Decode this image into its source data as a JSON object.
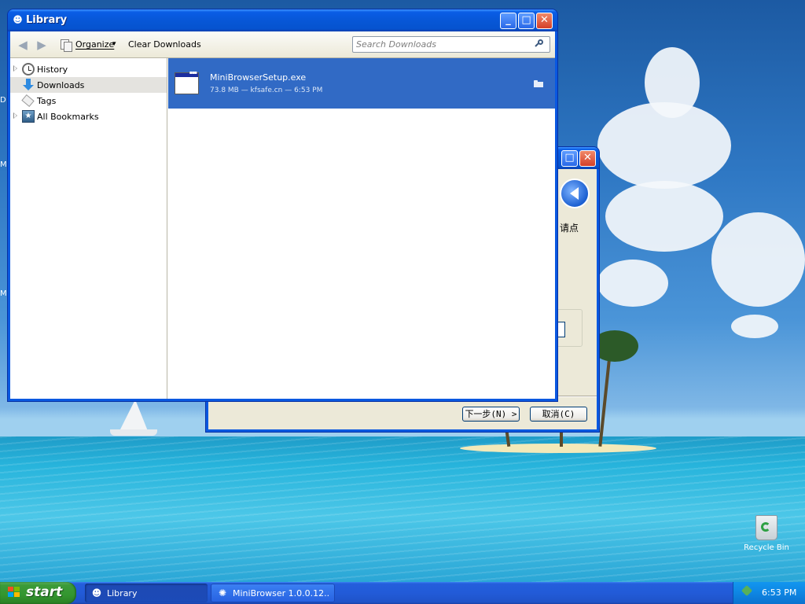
{
  "desktop": {
    "edge_labels": [
      "D",
      "M",
      "M"
    ],
    "recycle_bin_label": "Recycle Bin"
  },
  "installer": {
    "visible_text": "请点",
    "next_button": "下一步(N) >",
    "cancel_button": "取消(C)",
    "caption_buttons": {
      "maximize": "□",
      "close": "✕"
    }
  },
  "library": {
    "title": "Library",
    "caption_buttons": {
      "minimize": "_",
      "maximize": "□",
      "close": "✕"
    },
    "toolbar": {
      "organize_label": "Organize",
      "organize_arrow": "▾",
      "clear_downloads_label": "Clear Downloads",
      "search_placeholder": "Search Downloads"
    },
    "sidebar": {
      "items": [
        {
          "label": "History",
          "icon": "clock-icon",
          "expandable": true,
          "selected": false
        },
        {
          "label": "Downloads",
          "icon": "download-icon",
          "expandable": false,
          "selected": true
        },
        {
          "label": "Tags",
          "icon": "tag-icon",
          "expandable": false,
          "selected": false
        },
        {
          "label": "All Bookmarks",
          "icon": "bookmarks-star-icon",
          "expandable": true,
          "selected": false
        }
      ]
    },
    "downloads": [
      {
        "file_name": "MiniBrowserSetup.exe",
        "details": "73.8 MB — kfsafe.cn — 6:53 PM",
        "icon": "exe-file-icon",
        "action_icon": "open-folder-icon",
        "selected": true
      }
    ]
  },
  "taskbar": {
    "start_label": "start",
    "buttons": [
      {
        "label": "Library",
        "icon": "firefox-icon",
        "active": true
      },
      {
        "label": "MiniBrowser 1.0.0.12...",
        "icon": "minibrowser-icon",
        "active": false
      }
    ],
    "clock": "6:53 PM"
  },
  "colors": {
    "selection": "#316ac5",
    "titlebar": "#0757d7",
    "taskbar": "#245edc",
    "start": "#3c9a39",
    "window_face": "#ece9d8"
  }
}
